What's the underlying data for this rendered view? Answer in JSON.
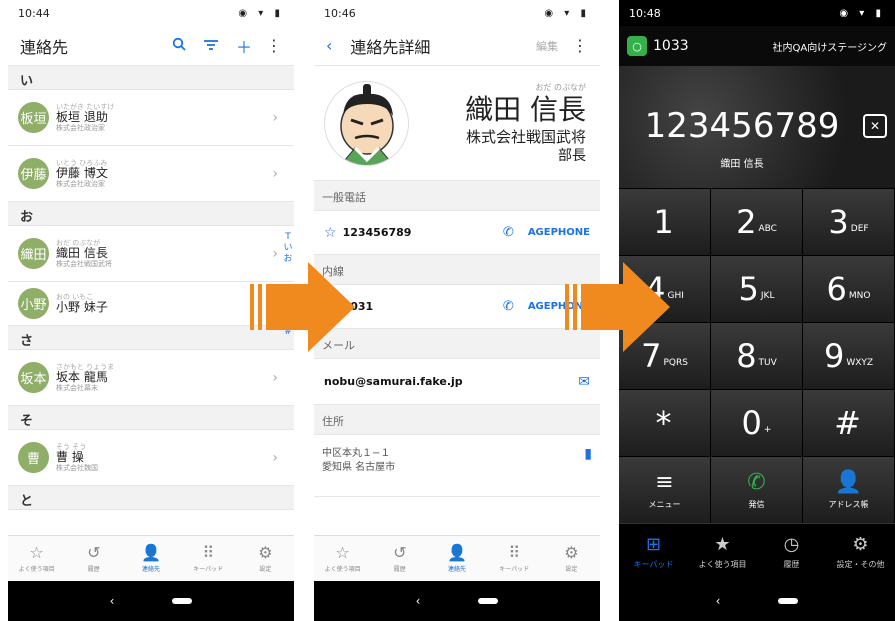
{
  "colors": {
    "accent": "#1a73e8",
    "avatar": "#8fae68",
    "arrow": "#f08a1e",
    "dial_green": "#34b14a"
  },
  "screen1": {
    "status": {
      "time": "10:44"
    },
    "title": "連絡先",
    "icons": [
      "search-icon",
      "filter-icon",
      "add-icon",
      "more-icon"
    ],
    "groups": [
      {
        "header": "い",
        "contacts": [
          {
            "avatar": "板垣",
            "ruby": "いたがき たいすけ",
            "name": "板垣 退助",
            "company": "株式会社政治家"
          },
          {
            "avatar": "伊藤",
            "ruby": "いとう ひろふみ",
            "name": "伊藤 博文",
            "company": "株式会社政治家"
          }
        ]
      },
      {
        "header": "お",
        "contacts": [
          {
            "avatar": "織田",
            "ruby": "おだ のぶなが",
            "name": "織田 信長",
            "company": "株式会社戦国武将"
          },
          {
            "avatar": "小野",
            "ruby": "おの いもこ",
            "name": "小野 妹子",
            "company": ""
          }
        ]
      },
      {
        "header": "さ",
        "contacts": [
          {
            "avatar": "坂本",
            "ruby": "さかもと りょうま",
            "name": "坂本 龍馬",
            "company": "株式会社幕末"
          }
        ]
      },
      {
        "header": "そ",
        "contacts": [
          {
            "avatar": "曹",
            "ruby": "そう そう",
            "name": "曹 操",
            "company": "株式会社魏国"
          }
        ]
      },
      {
        "header": "と",
        "contacts": []
      }
    ],
    "index_letters": [
      "T",
      "い",
      "お",
      "ふ",
      "む",
      "#"
    ],
    "bottom_nav": [
      {
        "icon": "star-icon",
        "label": "よく使う項目",
        "active": false
      },
      {
        "icon": "history-icon",
        "label": "履歴",
        "active": false
      },
      {
        "icon": "person-icon",
        "label": "連絡先",
        "active": true
      },
      {
        "icon": "keypad-icon",
        "label": "キーパッド",
        "active": false
      },
      {
        "icon": "gear-icon",
        "label": "設定",
        "active": false
      }
    ]
  },
  "screen2": {
    "status": {
      "time": "10:46"
    },
    "title": "連絡先詳細",
    "edit_label": "編集",
    "ruby": "おだ のぶなが",
    "name": "織田 信長",
    "company": "株式会社戦国武将",
    "job_title": "部長",
    "sections": {
      "general_phone": {
        "header": "一般電話",
        "number": "123456789",
        "action": "AGEPHONE"
      },
      "extension": {
        "header": "内線",
        "number": "1031",
        "action": "AGEPHONE"
      },
      "mail": {
        "header": "メール",
        "value": "nobu@samurai.fake.jp"
      },
      "address": {
        "header": "住所",
        "line1": "中区本丸１−１",
        "line2": "愛知県 名古屋市"
      }
    }
  },
  "screen3": {
    "status": {
      "time": "10:48"
    },
    "extension": "1033",
    "staging_label": "社内QA向けステージング",
    "dialed_number": "123456789",
    "dialed_name": "織田 信長",
    "keys": [
      {
        "digit": "1",
        "letters": ""
      },
      {
        "digit": "2",
        "letters": "ABC"
      },
      {
        "digit": "3",
        "letters": "DEF"
      },
      {
        "digit": "4",
        "letters": "GHI"
      },
      {
        "digit": "5",
        "letters": "JKL"
      },
      {
        "digit": "6",
        "letters": "MNO"
      },
      {
        "digit": "7",
        "letters": "PQRS"
      },
      {
        "digit": "8",
        "letters": "TUV"
      },
      {
        "digit": "9",
        "letters": "WXYZ"
      },
      {
        "digit": "*",
        "letters": ""
      },
      {
        "digit": "0",
        "letters": "+"
      },
      {
        "digit": "#",
        "letters": ""
      }
    ],
    "function_keys": [
      {
        "icon": "menu-icon",
        "label": "メニュー"
      },
      {
        "icon": "call-icon",
        "label": "発信"
      },
      {
        "icon": "address-book-icon",
        "label": "アドレス帳"
      }
    ],
    "bottom_nav": [
      {
        "icon": "keypad-icon",
        "label": "キーパッド",
        "active": true
      },
      {
        "icon": "star-icon",
        "label": "よく使う項目",
        "active": false
      },
      {
        "icon": "clock-icon",
        "label": "履歴",
        "active": false
      },
      {
        "icon": "gear-icon",
        "label": "設定・その他",
        "active": false
      }
    ]
  }
}
